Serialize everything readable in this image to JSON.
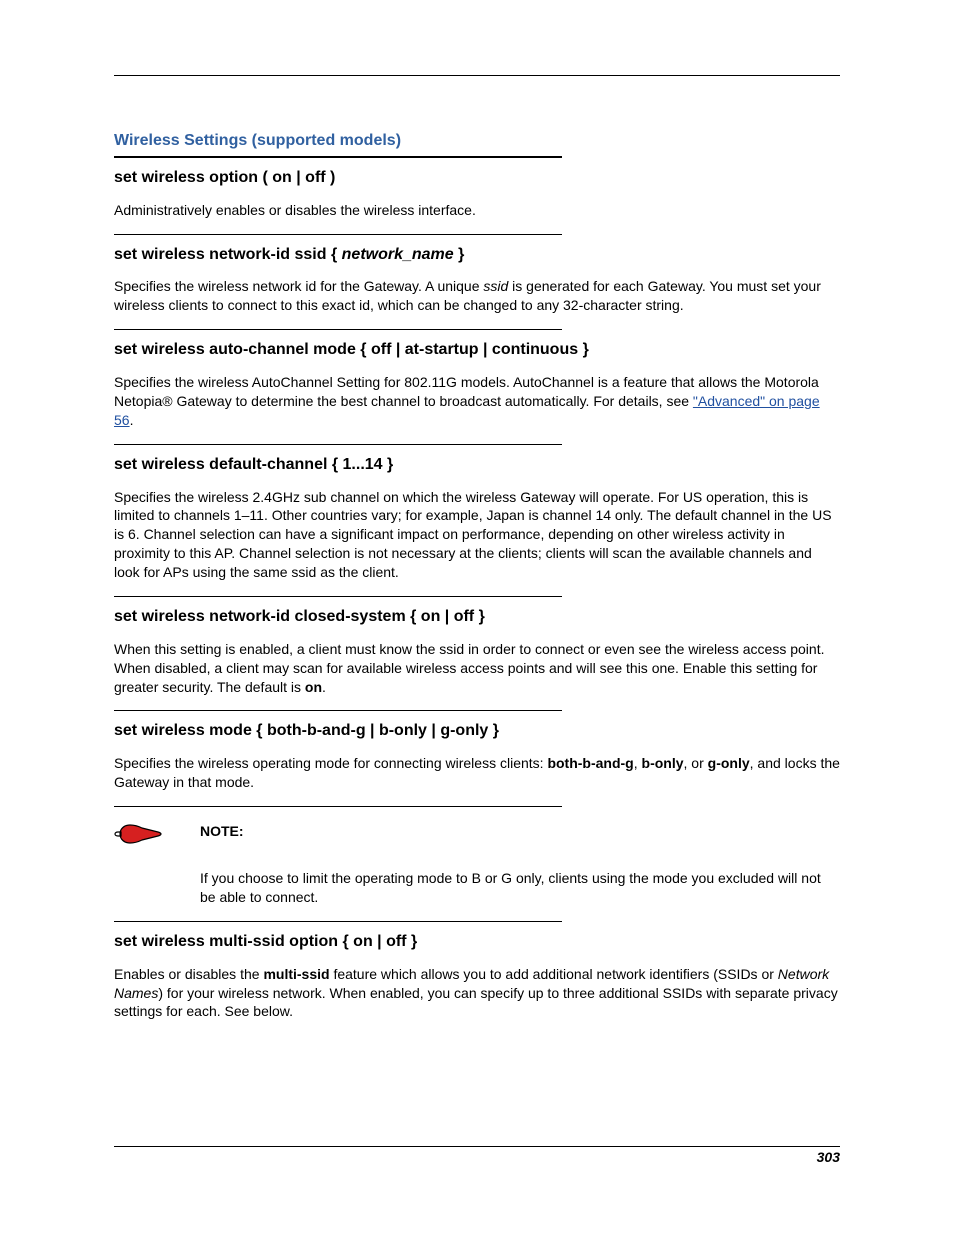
{
  "section_title": "Wireless Settings (supported models)",
  "items": [
    {
      "heading_parts": [
        {
          "t": "set wireless option ( on | off )",
          "italic": false
        }
      ],
      "body_parts": [
        {
          "t": "Administratively enables or disables the wireless interface."
        }
      ]
    },
    {
      "heading_parts": [
        {
          "t": "set wireless network-id ssid { ",
          "italic": false
        },
        {
          "t": "network_name",
          "italic": true
        },
        {
          "t": " }",
          "italic": false
        }
      ],
      "body_parts": [
        {
          "t": "Specifies the wireless network id for the Gateway. A unique "
        },
        {
          "t": "ssid",
          "italic": true
        },
        {
          "t": " is generated for each Gateway. You must set your wireless clients to connect to this exact id, which can be changed to any 32-character string."
        }
      ]
    },
    {
      "heading_parts": [
        {
          "t": "set wireless auto-channel mode { off | at-startup | continuous }",
          "italic": false
        }
      ],
      "body_parts": [
        {
          "t": "Specifies the wireless AutoChannel Setting for 802.11G models. AutoChannel is a feature that allows the Motorola Netopia® Gateway to determine the best channel to broadcast automatically. For details, see "
        },
        {
          "t": "\"Advanced\" on page 56",
          "link": true
        },
        {
          "t": "."
        }
      ]
    },
    {
      "heading_parts": [
        {
          "t": "set wireless default-channel { 1...14 }",
          "italic": false
        }
      ],
      "body_parts": [
        {
          "t": "Specifies the wireless 2.4GHz sub channel on which the wireless Gateway will operate. For US operation, this is limited to channels 1–11. Other countries vary; for example, Japan is channel 14 only. The default channel in the US is 6. Channel selection can have a significant impact on performance, depending on other wireless activity in proximity to this AP. Channel selection is not necessary at the clients; clients will scan the available channels and look for APs using the same ssid as the client."
        }
      ]
    },
    {
      "heading_parts": [
        {
          "t": "set wireless network-id closed-system { on | off }",
          "italic": false
        }
      ],
      "body_parts": [
        {
          "t": "When this setting is enabled, a client must know the ssid in order to connect or even see the wireless access point. When disabled, a client may scan for available wireless access points and will see this one. Enable this setting for greater security. The default is "
        },
        {
          "t": "on",
          "bold": true
        },
        {
          "t": "."
        }
      ]
    },
    {
      "heading_parts": [
        {
          "t": "set wireless mode { both-b-and-g | b-only | g-only }",
          "italic": false
        }
      ],
      "body_parts": [
        {
          "t": "Specifies the wireless operating mode for connecting wireless clients: "
        },
        {
          "t": "both-b-and-g",
          "bold": true
        },
        {
          "t": ", "
        },
        {
          "t": "b-only",
          "bold": true
        },
        {
          "t": ", or "
        },
        {
          "t": "g-only",
          "bold": true
        },
        {
          "t": ", and locks the Gateway in that mode."
        }
      ]
    }
  ],
  "note": {
    "label": "NOTE:",
    "text": "If you choose to limit the operating mode to B or G only, clients using the mode you excluded will not be able to connect."
  },
  "after_note": {
    "heading_parts": [
      {
        "t": "set wireless multi-ssid option { on | off }",
        "italic": false
      }
    ],
    "body_parts": [
      {
        "t": "Enables or disables the "
      },
      {
        "t": "multi-ssid",
        "bold": true
      },
      {
        "t": " feature which allows you to add additional network identifiers (SSIDs or "
      },
      {
        "t": "Network Names",
        "italic": true
      },
      {
        "t": ") for your wireless network. When enabled, you can specify up to three additional SSIDs with separate privacy settings for each. See below."
      }
    ]
  },
  "page_number": "303"
}
